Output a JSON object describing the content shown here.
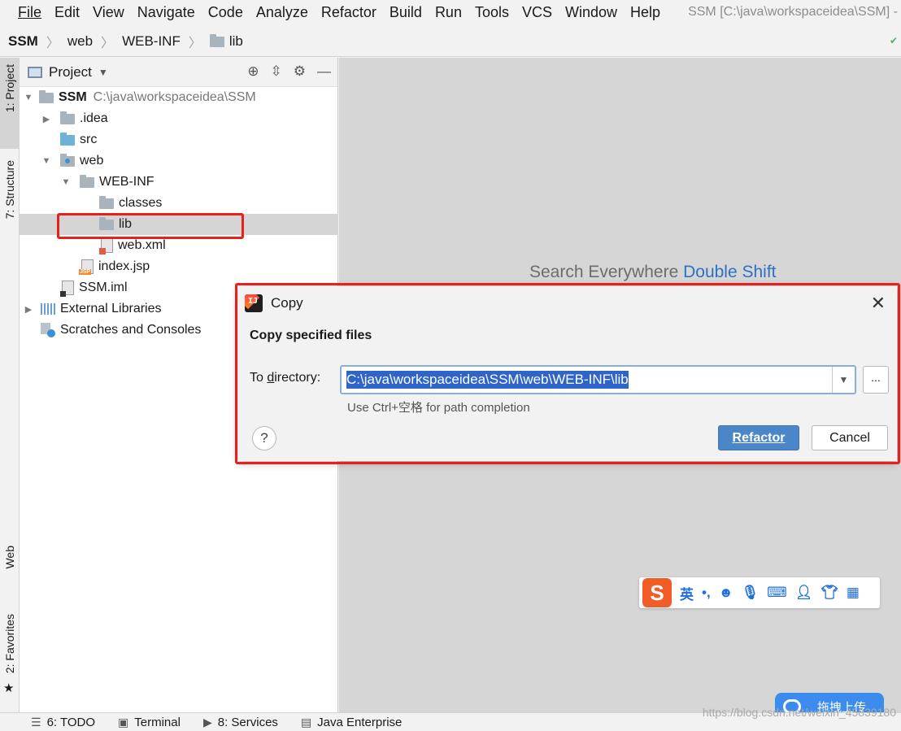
{
  "menubar": {
    "items": [
      "File",
      "Edit",
      "View",
      "Navigate",
      "Code",
      "Analyze",
      "Refactor",
      "Build",
      "Run",
      "Tools",
      "VCS",
      "Window",
      "Help"
    ],
    "window_title": "SSM [C:\\java\\workspaceidea\\SSM] - In"
  },
  "breadcrumb": [
    "SSM",
    "web",
    "WEB-INF",
    "lib"
  ],
  "stripe": {
    "project_tab": "1: Project",
    "structure_tab": "7: Structure",
    "web_tab": "Web",
    "favorites_tab": "2: Favorites"
  },
  "project_panel": {
    "title": "Project",
    "tree": [
      {
        "label": "SSM",
        "hint": "C:\\java\\workspaceidea\\SSM",
        "icon": "module-folder"
      },
      {
        "label": ".idea",
        "icon": "folder"
      },
      {
        "label": "src",
        "icon": "source-folder"
      },
      {
        "label": "web",
        "icon": "web-folder"
      },
      {
        "label": "WEB-INF",
        "icon": "folder"
      },
      {
        "label": "classes",
        "icon": "folder"
      },
      {
        "label": "lib",
        "icon": "folder",
        "selected": true
      },
      {
        "label": "web.xml",
        "icon": "xml-file"
      },
      {
        "label": "index.jsp",
        "icon": "jsp-file"
      },
      {
        "label": "SSM.iml",
        "icon": "iml-file"
      },
      {
        "label": "External Libraries",
        "icon": "library"
      },
      {
        "label": "Scratches and Consoles",
        "icon": "scratch"
      }
    ]
  },
  "editor": {
    "search_hint": "Search Everywhere",
    "search_shortcut": "Double Shift"
  },
  "dialog": {
    "title": "Copy",
    "heading": "Copy specified files",
    "dir_label": "To directory:",
    "dir_value": "C:\\java\\workspaceidea\\SSM\\web\\WEB-INF\\lib",
    "hint": "Use Ctrl+空格 for path completion",
    "browse": "...",
    "help": "?",
    "refactor_label": "Refactor",
    "cancel_label": "Cancel"
  },
  "ime": {
    "logo": "S",
    "lang": "英",
    "punct": "•,"
  },
  "upload": {
    "label": "拖拽上传"
  },
  "statusbar": {
    "items": [
      "6: TODO",
      "Terminal",
      "8: Services",
      "Java Enterprise"
    ]
  },
  "watermark": "https://blog.csdn.net/weixin_45839180",
  "colors": {
    "highlight": "#e8201a",
    "primary_button": "#4a86c8",
    "selection": "#2f65ca",
    "link_blue": "#2e6fc7"
  }
}
